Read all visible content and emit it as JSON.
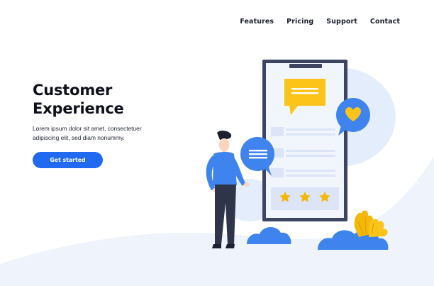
{
  "nav": {
    "items": [
      "Features",
      "Pricing",
      "Support",
      "Contact"
    ]
  },
  "hero": {
    "title_line1": "Customer",
    "title_line2": "Experience",
    "description_line1": "Lorem ipsum dolor sit amet, consectetuer",
    "description_line2": "adipiscing elit, sed diam nonummy.",
    "cta_label": "Get started"
  },
  "illustration": {
    "rating_stars": 3,
    "icons": [
      "message-bubble-icon",
      "heart-icon",
      "star-icon",
      "person-figure",
      "cloud-bush",
      "plant"
    ]
  },
  "colors": {
    "accent": "#1f6af0",
    "background_blob": "#eef3fc",
    "phone_frame": "#3d4563",
    "phone_screen": "#f1f5fc",
    "bubble_yellow": "#fcc419",
    "bubble_blue": "#3f84ee",
    "star": "#f5b70a",
    "heading": "#0e111b"
  }
}
